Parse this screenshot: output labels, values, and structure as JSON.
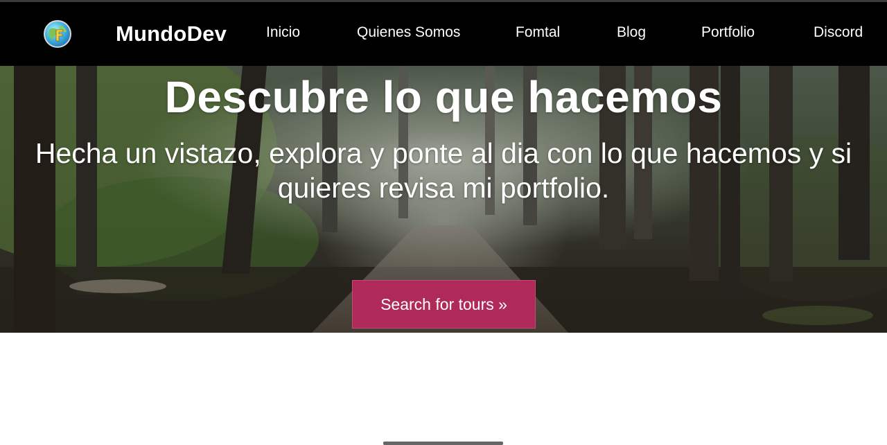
{
  "nav": {
    "brand": "MundoDev",
    "links": [
      "Inicio",
      "Quienes Somos",
      "Fomtal",
      "Blog",
      "Portfolio",
      "Discord"
    ]
  },
  "hero": {
    "title": "Descubre lo que hacemos",
    "subtitle": "Hecha un vistazo, explora y ponte al dia con lo que hacemos y si quieres revisa mi portfolio.",
    "cta_label": "Search for tours »"
  },
  "icons": {
    "logo": "globe-logo-icon"
  },
  "colors": {
    "navbar": "#000000",
    "cta": "#b02a59",
    "text": "#ffffff"
  }
}
